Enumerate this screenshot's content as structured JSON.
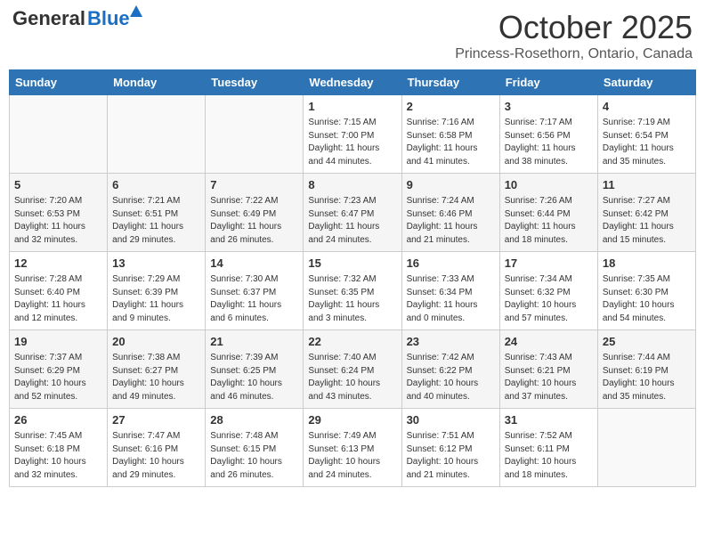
{
  "header": {
    "logo_general": "General",
    "logo_blue": "Blue",
    "month": "October 2025",
    "location": "Princess-Rosethorn, Ontario, Canada"
  },
  "days_of_week": [
    "Sunday",
    "Monday",
    "Tuesday",
    "Wednesday",
    "Thursday",
    "Friday",
    "Saturday"
  ],
  "weeks": [
    [
      {
        "day": "",
        "info": ""
      },
      {
        "day": "",
        "info": ""
      },
      {
        "day": "",
        "info": ""
      },
      {
        "day": "1",
        "info": "Sunrise: 7:15 AM\nSunset: 7:00 PM\nDaylight: 11 hours and 44 minutes."
      },
      {
        "day": "2",
        "info": "Sunrise: 7:16 AM\nSunset: 6:58 PM\nDaylight: 11 hours and 41 minutes."
      },
      {
        "day": "3",
        "info": "Sunrise: 7:17 AM\nSunset: 6:56 PM\nDaylight: 11 hours and 38 minutes."
      },
      {
        "day": "4",
        "info": "Sunrise: 7:19 AM\nSunset: 6:54 PM\nDaylight: 11 hours and 35 minutes."
      }
    ],
    [
      {
        "day": "5",
        "info": "Sunrise: 7:20 AM\nSunset: 6:53 PM\nDaylight: 11 hours and 32 minutes."
      },
      {
        "day": "6",
        "info": "Sunrise: 7:21 AM\nSunset: 6:51 PM\nDaylight: 11 hours and 29 minutes."
      },
      {
        "day": "7",
        "info": "Sunrise: 7:22 AM\nSunset: 6:49 PM\nDaylight: 11 hours and 26 minutes."
      },
      {
        "day": "8",
        "info": "Sunrise: 7:23 AM\nSunset: 6:47 PM\nDaylight: 11 hours and 24 minutes."
      },
      {
        "day": "9",
        "info": "Sunrise: 7:24 AM\nSunset: 6:46 PM\nDaylight: 11 hours and 21 minutes."
      },
      {
        "day": "10",
        "info": "Sunrise: 7:26 AM\nSunset: 6:44 PM\nDaylight: 11 hours and 18 minutes."
      },
      {
        "day": "11",
        "info": "Sunrise: 7:27 AM\nSunset: 6:42 PM\nDaylight: 11 hours and 15 minutes."
      }
    ],
    [
      {
        "day": "12",
        "info": "Sunrise: 7:28 AM\nSunset: 6:40 PM\nDaylight: 11 hours and 12 minutes."
      },
      {
        "day": "13",
        "info": "Sunrise: 7:29 AM\nSunset: 6:39 PM\nDaylight: 11 hours and 9 minutes."
      },
      {
        "day": "14",
        "info": "Sunrise: 7:30 AM\nSunset: 6:37 PM\nDaylight: 11 hours and 6 minutes."
      },
      {
        "day": "15",
        "info": "Sunrise: 7:32 AM\nSunset: 6:35 PM\nDaylight: 11 hours and 3 minutes."
      },
      {
        "day": "16",
        "info": "Sunrise: 7:33 AM\nSunset: 6:34 PM\nDaylight: 11 hours and 0 minutes."
      },
      {
        "day": "17",
        "info": "Sunrise: 7:34 AM\nSunset: 6:32 PM\nDaylight: 10 hours and 57 minutes."
      },
      {
        "day": "18",
        "info": "Sunrise: 7:35 AM\nSunset: 6:30 PM\nDaylight: 10 hours and 54 minutes."
      }
    ],
    [
      {
        "day": "19",
        "info": "Sunrise: 7:37 AM\nSunset: 6:29 PM\nDaylight: 10 hours and 52 minutes."
      },
      {
        "day": "20",
        "info": "Sunrise: 7:38 AM\nSunset: 6:27 PM\nDaylight: 10 hours and 49 minutes."
      },
      {
        "day": "21",
        "info": "Sunrise: 7:39 AM\nSunset: 6:25 PM\nDaylight: 10 hours and 46 minutes."
      },
      {
        "day": "22",
        "info": "Sunrise: 7:40 AM\nSunset: 6:24 PM\nDaylight: 10 hours and 43 minutes."
      },
      {
        "day": "23",
        "info": "Sunrise: 7:42 AM\nSunset: 6:22 PM\nDaylight: 10 hours and 40 minutes."
      },
      {
        "day": "24",
        "info": "Sunrise: 7:43 AM\nSunset: 6:21 PM\nDaylight: 10 hours and 37 minutes."
      },
      {
        "day": "25",
        "info": "Sunrise: 7:44 AM\nSunset: 6:19 PM\nDaylight: 10 hours and 35 minutes."
      }
    ],
    [
      {
        "day": "26",
        "info": "Sunrise: 7:45 AM\nSunset: 6:18 PM\nDaylight: 10 hours and 32 minutes."
      },
      {
        "day": "27",
        "info": "Sunrise: 7:47 AM\nSunset: 6:16 PM\nDaylight: 10 hours and 29 minutes."
      },
      {
        "day": "28",
        "info": "Sunrise: 7:48 AM\nSunset: 6:15 PM\nDaylight: 10 hours and 26 minutes."
      },
      {
        "day": "29",
        "info": "Sunrise: 7:49 AM\nSunset: 6:13 PM\nDaylight: 10 hours and 24 minutes."
      },
      {
        "day": "30",
        "info": "Sunrise: 7:51 AM\nSunset: 6:12 PM\nDaylight: 10 hours and 21 minutes."
      },
      {
        "day": "31",
        "info": "Sunrise: 7:52 AM\nSunset: 6:11 PM\nDaylight: 10 hours and 18 minutes."
      },
      {
        "day": "",
        "info": ""
      }
    ]
  ]
}
